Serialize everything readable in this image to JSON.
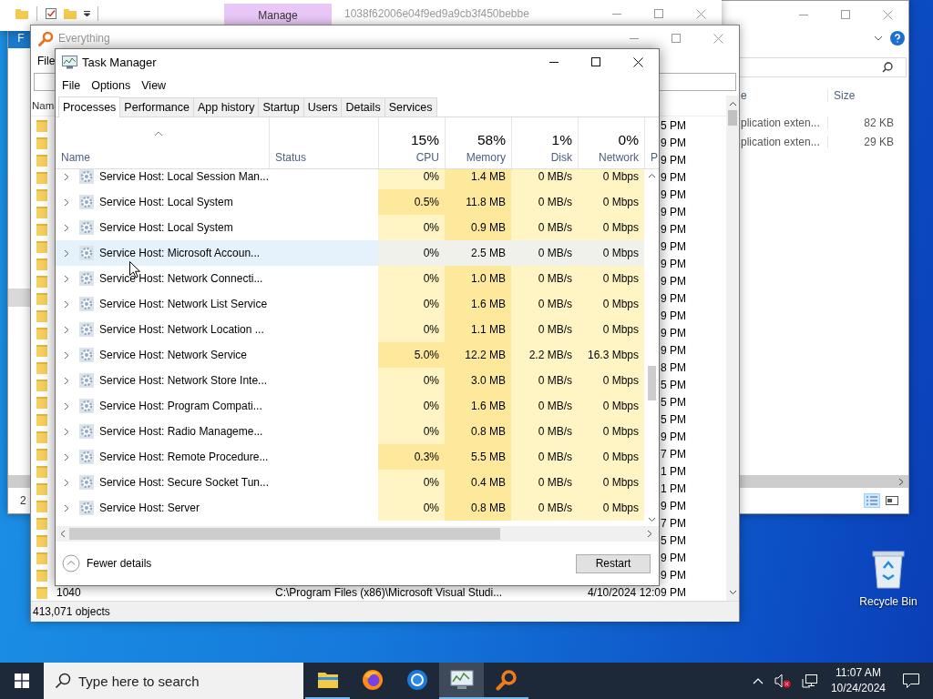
{
  "explorer_front": {
    "manage_tab": "Manage",
    "title": "1038f62006e04f9ed9a9cb3f450bebbe"
  },
  "explorer_back": {
    "file_tab": "F",
    "columns": [
      "e",
      "Size"
    ],
    "rows": [
      {
        "type": "plication exten...",
        "size": "82 KB"
      },
      {
        "type": "plication exten...",
        "size": "29 KB"
      }
    ],
    "status": "2"
  },
  "everything": {
    "title": "Everything",
    "menu": [
      "File"
    ],
    "name_header": "Nam",
    "rows": [
      {
        "modified": "5 PM"
      },
      {
        "modified": "9 PM"
      },
      {
        "modified": "9 PM"
      },
      {
        "modified": "9 PM"
      },
      {
        "modified": "9 PM"
      },
      {
        "modified": "9 PM"
      },
      {
        "modified": "9 PM"
      },
      {
        "modified": "9 PM"
      },
      {
        "modified": "9 PM"
      },
      {
        "modified": "9 PM"
      },
      {
        "modified": "9 PM"
      },
      {
        "modified": "9 PM"
      },
      {
        "modified": "9 PM"
      },
      {
        "modified": "9 PM"
      },
      {
        "modified": "8 PM"
      },
      {
        "modified": "5 PM"
      },
      {
        "modified": "5 PM"
      },
      {
        "modified": "5 PM"
      },
      {
        "modified": "9 PM"
      },
      {
        "modified": "7 PM"
      },
      {
        "modified": "1 PM"
      },
      {
        "modified": "1 PM"
      },
      {
        "modified": "9 PM"
      },
      {
        "modified": "7 PM"
      },
      {
        "modified": "5 PM"
      },
      {
        "modified": "9 PM"
      },
      {
        "modified": "9 PM"
      },
      {
        "name": "1040",
        "path": "C:\\Program Files (x86)\\Microsoft Visual Studi...",
        "modified": "4/10/2024 12:09 PM"
      }
    ],
    "status": "413,071 objects"
  },
  "task_manager": {
    "title": "Task Manager",
    "menu": [
      "File",
      "Options",
      "View"
    ],
    "tabs": [
      {
        "label": "Processes",
        "selected": true
      },
      {
        "label": "Performance",
        "selected": false
      },
      {
        "label": "App history",
        "selected": false
      },
      {
        "label": "Startup",
        "selected": false
      },
      {
        "label": "Users",
        "selected": false
      },
      {
        "label": "Details",
        "selected": false
      },
      {
        "label": "Services",
        "selected": false
      }
    ],
    "columns": [
      {
        "kind": "text",
        "label": "Name",
        "sorted": true
      },
      {
        "kind": "text",
        "label": "Status",
        "sorted": false
      },
      {
        "kind": "metric",
        "usage": "15%",
        "label": "CPU",
        "sorted": false,
        "heavy": false
      },
      {
        "kind": "metric",
        "usage": "58%",
        "label": "Memory",
        "sorted": false,
        "heavy": true
      },
      {
        "kind": "metric",
        "usage": "1%",
        "label": "Disk",
        "sorted": false,
        "heavy": false
      },
      {
        "kind": "metric",
        "usage": "0%",
        "label": "Network",
        "sorted": false,
        "heavy": false
      },
      {
        "kind": "cut",
        "label": "P",
        "sorted": false
      }
    ],
    "rows": [
      {
        "name": "Service Host: Local Session Man...",
        "values": [
          "0%",
          "1.4 MB",
          "0 MB/s",
          "0 Mbps"
        ],
        "busy": false,
        "hovered": false
      },
      {
        "name": "Service Host: Local System",
        "values": [
          "0.5%",
          "11.8 MB",
          "0 MB/s",
          "0 Mbps"
        ],
        "busy": true,
        "hovered": false
      },
      {
        "name": "Service Host: Local System",
        "values": [
          "0%",
          "0.9 MB",
          "0 MB/s",
          "0 Mbps"
        ],
        "busy": false,
        "hovered": false
      },
      {
        "name": "Service Host: Microsoft Accoun...",
        "values": [
          "0%",
          "2.5 MB",
          "0 MB/s",
          "0 Mbps"
        ],
        "busy": false,
        "hovered": true
      },
      {
        "name": "Service Host: Network Connecti...",
        "values": [
          "0%",
          "1.0 MB",
          "0 MB/s",
          "0 Mbps"
        ],
        "busy": false,
        "hovered": false
      },
      {
        "name": "Service Host: Network List Service",
        "values": [
          "0%",
          "1.6 MB",
          "0 MB/s",
          "0 Mbps"
        ],
        "busy": false,
        "hovered": false
      },
      {
        "name": "Service Host: Network Location ...",
        "values": [
          "0%",
          "1.1 MB",
          "0 MB/s",
          "0 Mbps"
        ],
        "busy": false,
        "hovered": false
      },
      {
        "name": "Service Host: Network Service",
        "values": [
          "5.0%",
          "12.2 MB",
          "2.2 MB/s",
          "16.3 Mbps"
        ],
        "busy": true,
        "hovered": false
      },
      {
        "name": "Service Host: Network Store Inte...",
        "values": [
          "0%",
          "3.0 MB",
          "0 MB/s",
          "0 Mbps"
        ],
        "busy": false,
        "hovered": false
      },
      {
        "name": "Service Host: Program Compati...",
        "values": [
          "0%",
          "1.6 MB",
          "0 MB/s",
          "0 Mbps"
        ],
        "busy": false,
        "hovered": false
      },
      {
        "name": "Service Host: Radio Manageme...",
        "values": [
          "0%",
          "0.8 MB",
          "0 MB/s",
          "0 Mbps"
        ],
        "busy": false,
        "hovered": false
      },
      {
        "name": "Service Host: Remote Procedure...",
        "values": [
          "0.3%",
          "5.5 MB",
          "0 MB/s",
          "0 Mbps"
        ],
        "busy": true,
        "hovered": false
      },
      {
        "name": "Service Host: Secure Socket Tun...",
        "values": [
          "0%",
          "0.4 MB",
          "0 MB/s",
          "0 Mbps"
        ],
        "busy": false,
        "hovered": false
      },
      {
        "name": "Service Host: Server",
        "values": [
          "0%",
          "0.8 MB",
          "0 MB/s",
          "0 Mbps"
        ],
        "busy": false,
        "hovered": false
      }
    ],
    "fewer_details": "Fewer details",
    "restart": "Restart"
  },
  "desktop_icons": [
    {
      "label": "Recycle Bin"
    }
  ],
  "taskbar": {
    "search_placeholder": "Type here to search",
    "apps": [
      {
        "kind": "explorer",
        "running": true,
        "active": false
      },
      {
        "kind": "firefox",
        "running": false,
        "active": false
      },
      {
        "kind": "chrome",
        "running": false,
        "active": false
      },
      {
        "kind": "taskmgr",
        "running": true,
        "active": true
      },
      {
        "kind": "everything",
        "running": true,
        "active": false
      }
    ],
    "volume_muted": true,
    "time": "11:07 AM",
    "date": "10/24/2024"
  }
}
